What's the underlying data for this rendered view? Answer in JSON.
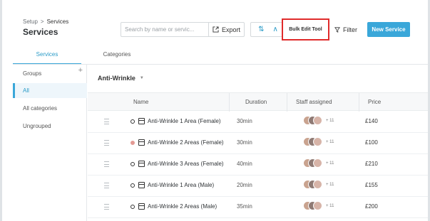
{
  "header": {
    "breadcrumb_parent": "Setup",
    "breadcrumb_sep": ">",
    "breadcrumb_current": "Services",
    "title": "Services"
  },
  "toolbar": {
    "search_placeholder": "Search by name or servic...",
    "export_label": "Export",
    "sort_icon": "⇅",
    "collapse_icon": "∧",
    "bulk_edit_label": "Bulk Edit Tool",
    "filter_label": "Filter",
    "new_service_label": "New Service"
  },
  "tabs": [
    {
      "label": "Services"
    },
    {
      "label": "Categories"
    }
  ],
  "sidebar": {
    "groups_label": "Groups",
    "add_symbol": "+",
    "items": [
      {
        "label": "All"
      },
      {
        "label": "All categories"
      },
      {
        "label": "Ungrouped"
      }
    ]
  },
  "main": {
    "category_select": "Anti-Wrinkle",
    "columns": [
      "Name",
      "Duration",
      "Staff assigned",
      "Price"
    ],
    "rows": [
      {
        "name": "Anti-Wrinkle 1 Area (Female)",
        "duration": "30min",
        "more": "+ 11",
        "price": "£140"
      },
      {
        "name": "Anti-Wrinkle 2 Areas (Female)",
        "duration": "30min",
        "more": "+ 11",
        "price": "£100"
      },
      {
        "name": "Anti-Wrinkle 3 Areas (Female)",
        "duration": "40min",
        "more": "+ 11",
        "price": "£210"
      },
      {
        "name": "Anti-Wrinkle 1 Area (Male)",
        "duration": "20min",
        "more": "+ 11",
        "price": "£155"
      },
      {
        "name": "Anti-Wrinkle 2 Areas (Male)",
        "duration": "35min",
        "more": "+ 11",
        "price": "£200"
      }
    ]
  },
  "colors": {
    "accent": "#3aa7d9",
    "highlight_border": "#e02b2b",
    "status_dot_pink": "#e39a94"
  }
}
